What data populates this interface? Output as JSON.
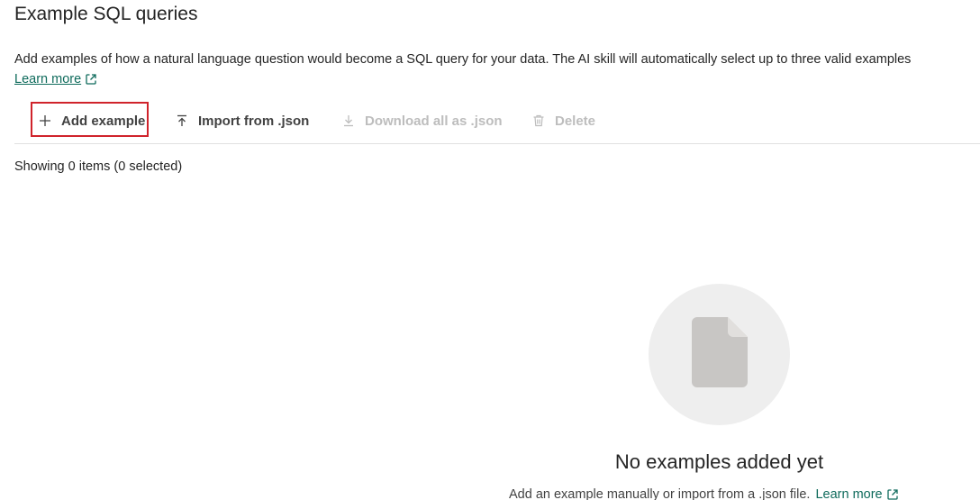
{
  "header": {
    "title": "Example SQL queries",
    "description": "Add examples of how a natural language question would become a SQL query for your data. The AI skill will automatically select up to three valid examples",
    "learn_more": "Learn more"
  },
  "toolbar": {
    "add_example": "Add example",
    "import_json": "Import from .json",
    "download_json": "Download all as .json",
    "delete": "Delete"
  },
  "list": {
    "count_text": "Showing 0 items (0 selected)"
  },
  "empty_state": {
    "title": "No examples added yet",
    "subtitle": "Add an example manually or import from a .json file.",
    "learn_more": "Learn more"
  },
  "colors": {
    "link": "#0f6b5c",
    "highlight": "#d0232b",
    "disabled": "#bdbdbd"
  },
  "icons": {
    "add": "plus-icon",
    "import": "arrow-up-bar-icon",
    "download": "arrow-down-bar-icon",
    "delete": "trash-icon",
    "external": "open-external-icon",
    "empty": "document-icon"
  }
}
